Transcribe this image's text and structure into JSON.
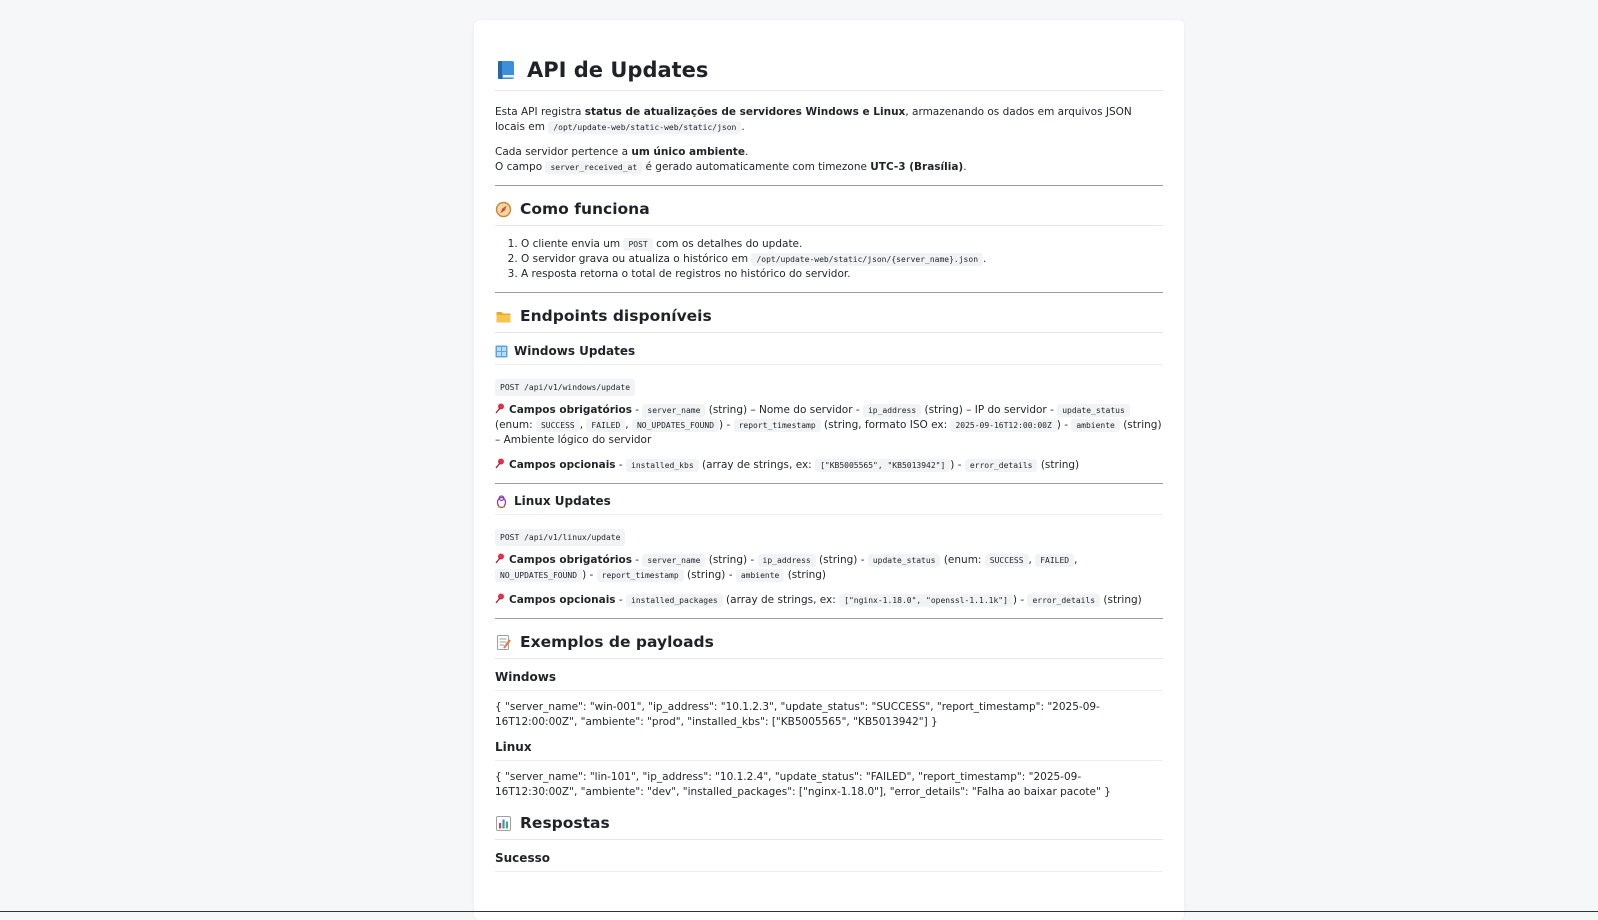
{
  "title": "API de Updates",
  "intro": {
    "p1_a": "Esta API registra ",
    "p1_bold": "status de atualizações de servidores Windows e Linux",
    "p1_b": ", armazenando os dados em arquivos JSON locais em ",
    "p1_code": "/opt/update-web/static-web/static/json",
    "p1_end": ".",
    "p2_a": "Cada servidor pertence a ",
    "p2_bold": "um único ambiente",
    "p2_end": ".",
    "p3_a": "O campo ",
    "p3_code": "server_received_at",
    "p3_b": " é gerado automaticamente com timezone ",
    "p3_bold": "UTC-3 (Brasília)",
    "p3_end": "."
  },
  "como": {
    "title": "Como funciona",
    "s1_a": "O cliente envia um ",
    "s1_code": "POST",
    "s1_b": " com os detalhes do update.",
    "s2_a": "O servidor grava ou atualiza o histórico em ",
    "s2_code": "/opt/update-web/static/json/{server_name}.json",
    "s2_b": ".",
    "s3": "A resposta retorna o total de registros no histórico do servidor."
  },
  "endpoints": {
    "title": "Endpoints disponíveis",
    "win": {
      "title": "Windows Updates",
      "endpoint": "POST /api/v1/windows/update",
      "req_label": "Campos obrigatórios",
      "dash": " - ",
      "c1": "server_name",
      "t1": " (string) – Nome do servidor - ",
      "c2": "ip_address",
      "t2": " (string) – IP do servidor - ",
      "c3": "update_status",
      "t3": " (enum: ",
      "c4": "SUCCESS",
      "sep": ", ",
      "c5": "FAILED",
      "c6": "NO_UPDATES_FOUND",
      "t4": ") - ",
      "c7": "report_timestamp",
      "t5": " (string, formato ISO ex: ",
      "c8": "2025-09-16T12:00:00Z",
      "t6": ") - ",
      "c9": "ambiente",
      "t7": " (string) – Ambiente lógico do servidor",
      "opt_label": "Campos opcionais",
      "o1": "installed_kbs",
      "ot1": " (array de strings, ex: ",
      "o2": "[\"KB5005565\", \"KB5013942\"]",
      "ot2": ") - ",
      "o3": "error_details",
      "ot3": " (string)"
    },
    "linux": {
      "title": "Linux Updates",
      "endpoint": "POST /api/v1/linux/update",
      "req_label": "Campos obrigatórios",
      "dash": " - ",
      "c1": "server_name",
      "t1": " (string) - ",
      "c2": "ip_address",
      "t2": " (string) - ",
      "c3": "update_status",
      "t3": " (enum: ",
      "c4": "SUCCESS",
      "sep": ", ",
      "c5": "FAILED",
      "c6": "NO_UPDATES_FOUND",
      "t4": ") - ",
      "c7": "report_timestamp",
      "t5": " (string) - ",
      "c8": "ambiente",
      "t6": " (string)",
      "opt_label": "Campos opcionais",
      "o1": "installed_packages",
      "ot1": " (array de strings, ex: ",
      "o2": "[\"nginx-1.18.0\", \"openssl-1.1.1k\"]",
      "ot2": ") - ",
      "o3": "error_details",
      "ot3": " (string)"
    }
  },
  "exemplos": {
    "title": "Exemplos de payloads",
    "win_title": "Windows",
    "win_payload": "{ \"server_name\": \"win-001\", \"ip_address\": \"10.1.2.3\", \"update_status\": \"SUCCESS\", \"report_timestamp\": \"2025-09-16T12:00:00Z\", \"ambiente\": \"prod\", \"installed_kbs\": [\"KB5005565\", \"KB5013942\"] }",
    "linux_title": "Linux",
    "linux_payload": "{ \"server_name\": \"lin-101\", \"ip_address\": \"10.1.2.4\", \"update_status\": \"FAILED\", \"report_timestamp\": \"2025-09-16T12:30:00Z\", \"ambiente\": \"dev\", \"installed_packages\": [\"nginx-1.18.0\"], \"error_details\": \"Falha ao baixar pacote\" }"
  },
  "respostas": {
    "title": "Respostas",
    "sucesso": "Sucesso"
  }
}
